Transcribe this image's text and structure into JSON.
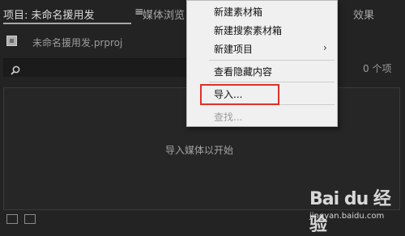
{
  "tabs": {
    "project_tab": "项目: 未命名援用发",
    "menu_glyph": "≡",
    "media_browser_tab": "媒体浏览",
    "effects_tab": "效果"
  },
  "project": {
    "file_name": "未命名援用发.prproj"
  },
  "search": {
    "value": "",
    "item_count": "0 个项"
  },
  "drop_area": {
    "hint": "导入媒体以开始"
  },
  "context_menu": {
    "items": [
      {
        "label": "新建素材箱",
        "enabled": true
      },
      {
        "label": "新建搜索素材箱",
        "enabled": true
      },
      {
        "label": "新建项目",
        "enabled": true,
        "submenu": true
      },
      {
        "label": "查看隐藏内容",
        "enabled": true
      },
      {
        "label": "导入...",
        "enabled": true,
        "highlighted": true
      },
      {
        "label": "查找...",
        "enabled": false
      }
    ],
    "submenu_arrow": "›"
  },
  "watermark": {
    "logo": "Bai du 经验",
    "url": "jingyan.baidu.com"
  },
  "colors": {
    "panel_bg": "#232323",
    "menu_bg": "#f0f0f0",
    "highlight": "#e0302a"
  }
}
